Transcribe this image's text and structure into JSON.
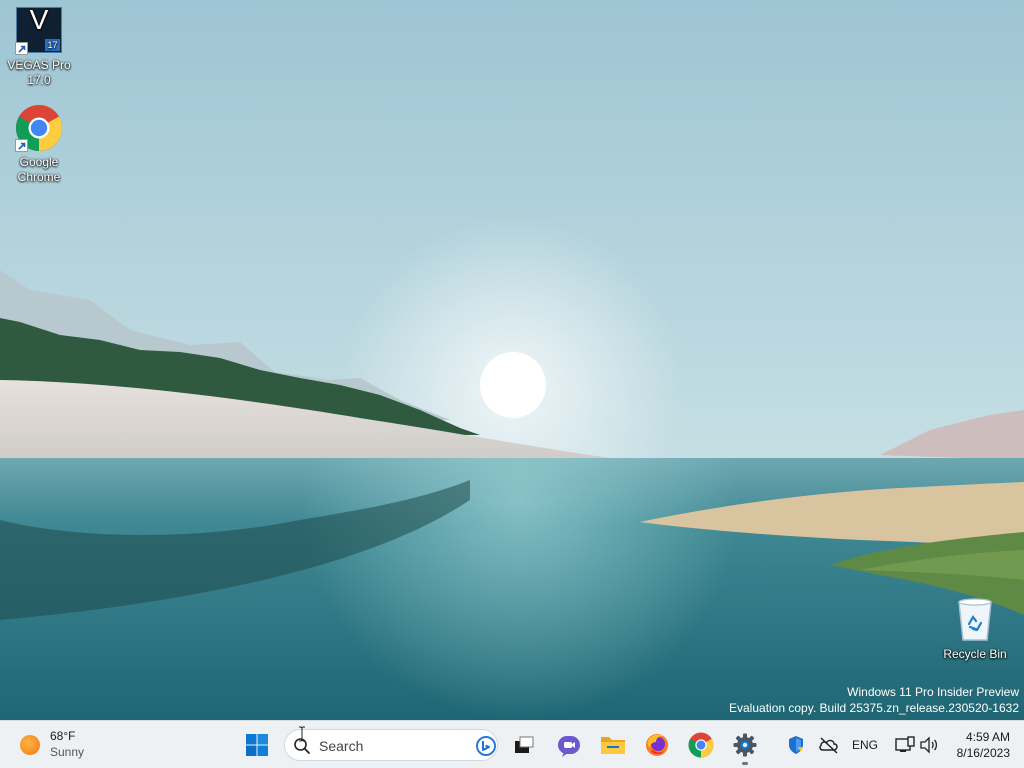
{
  "desktop": {
    "icons": [
      {
        "id": "vegas",
        "label_line1": "VEGAS Pro",
        "label_line2": "17.0",
        "icon": "vegas-pro-icon",
        "badge": "17"
      },
      {
        "id": "chrome",
        "label_line1": "Google",
        "label_line2": "Chrome",
        "icon": "chrome-icon"
      },
      {
        "id": "recycle",
        "label": "Recycle Bin",
        "icon": "recycle-bin-icon"
      }
    ],
    "watermark": {
      "line1": "Windows 11 Pro Insider Preview",
      "line2": "Evaluation copy. Build 25375.zn_release.230520-1632"
    }
  },
  "taskbar": {
    "weather": {
      "temperature": "68°F",
      "condition": "Sunny",
      "icon": "sun-icon"
    },
    "search": {
      "placeholder": "Search"
    },
    "pinned": [
      {
        "name": "start-button",
        "icon": "windows-logo-icon"
      },
      {
        "name": "task-view-button",
        "icon": "task-view-icon"
      },
      {
        "name": "teams-chat-button",
        "icon": "teams-chat-icon"
      },
      {
        "name": "file-explorer-button",
        "icon": "folder-icon"
      },
      {
        "name": "firefox-button",
        "icon": "firefox-icon"
      },
      {
        "name": "chrome-button",
        "icon": "chrome-icon"
      },
      {
        "name": "settings-button",
        "icon": "gear-icon",
        "running": true
      }
    ],
    "tray": {
      "language": "ENG",
      "icons": [
        "security-shield-icon",
        "onedrive-offline-icon",
        "network-icon",
        "volume-icon"
      ]
    },
    "clock": {
      "time": "4:59 AM",
      "date": "8/16/2023"
    }
  },
  "colors": {
    "sky": "#a9cdd7",
    "water": "#2f7a86",
    "taskbar": "#eef1f4",
    "accent": "#0067c0"
  }
}
